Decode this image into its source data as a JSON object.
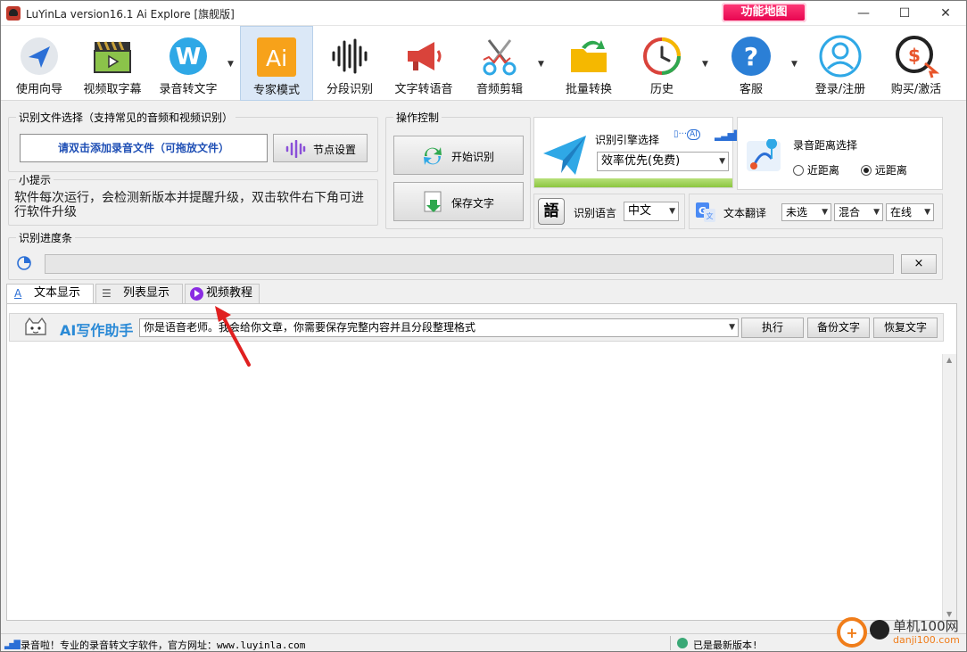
{
  "window": {
    "title": "LuYinLa version16.1 Ai Explore [旗舰版]",
    "func_map": "功能地图",
    "min": "—",
    "max": "☐",
    "close": "✕"
  },
  "toolbar": {
    "items": [
      {
        "label": "使用向导",
        "icon": "navigation-arrow-icon"
      },
      {
        "label": "视频取字幕",
        "icon": "film-clapper-icon"
      },
      {
        "label": "录音转文字",
        "icon": "w-circle-icon"
      },
      {
        "label": "专家模式",
        "icon": "ai-icon"
      },
      {
        "label": "分段识别",
        "icon": "waveform-icon"
      },
      {
        "label": "文字转语音",
        "icon": "megaphone-icon"
      },
      {
        "label": "音频剪辑",
        "icon": "scissors-icon"
      },
      {
        "label": "批量转换",
        "icon": "folder-arrow-icon"
      },
      {
        "label": "历史",
        "icon": "history-clock-icon"
      },
      {
        "label": "客服",
        "icon": "help-question-icon"
      },
      {
        "label": "登录/注册",
        "icon": "user-icon"
      },
      {
        "label": "购买/激活",
        "icon": "purchase-dollar-icon"
      }
    ]
  },
  "file_select": {
    "title": "识别文件选择（支持常见的音频和视频识别）",
    "add_file": "请双击添加录音文件（可拖放文件）",
    "node_settings": "节点设置"
  },
  "tips": {
    "title": "小提示",
    "text": "软件每次运行，会检测新版本并提醒升级，双击软件右下角可进行软件升级"
  },
  "operation": {
    "title": "操作控制",
    "start": "开始识别",
    "save": "保存文字"
  },
  "engine": {
    "label": "识别引擎选择",
    "ai_badge": "AI",
    "value": "效率优先(免费)"
  },
  "distance": {
    "label": "录音距离选择",
    "near": "近距离",
    "far": "远距离",
    "selected": "far"
  },
  "language": {
    "glyph": "語",
    "label": "识别语言",
    "value": "中文"
  },
  "translate": {
    "label": "文本翻译",
    "opt1": "未选",
    "opt2": "混合",
    "opt3": "在线"
  },
  "progress": {
    "title": "识别进度条",
    "value": 0,
    "clear": "×"
  },
  "tabs": {
    "text": "文本显示",
    "list": "列表显示",
    "video": "视频教程"
  },
  "ai_writer": {
    "title": "AI写作助手",
    "prompt": "你是语音老师。我会给你文章，你需要保存完整内容并且分段整理格式",
    "run": "执行",
    "backup": "备份文字",
    "restore": "恢复文字"
  },
  "status": {
    "left": "录音啦！专业的录音转文字软件，官方网址：www.luyinla.com",
    "right": "已是最新版本!"
  },
  "watermark": {
    "cn": "单机100网",
    "url": "danji100.com"
  },
  "colors": {
    "accent": "#2b6fd6",
    "ai_orange": "#f7a21a",
    "func_map_pink": "#e6004c",
    "engine_green": "#8cc63f"
  }
}
